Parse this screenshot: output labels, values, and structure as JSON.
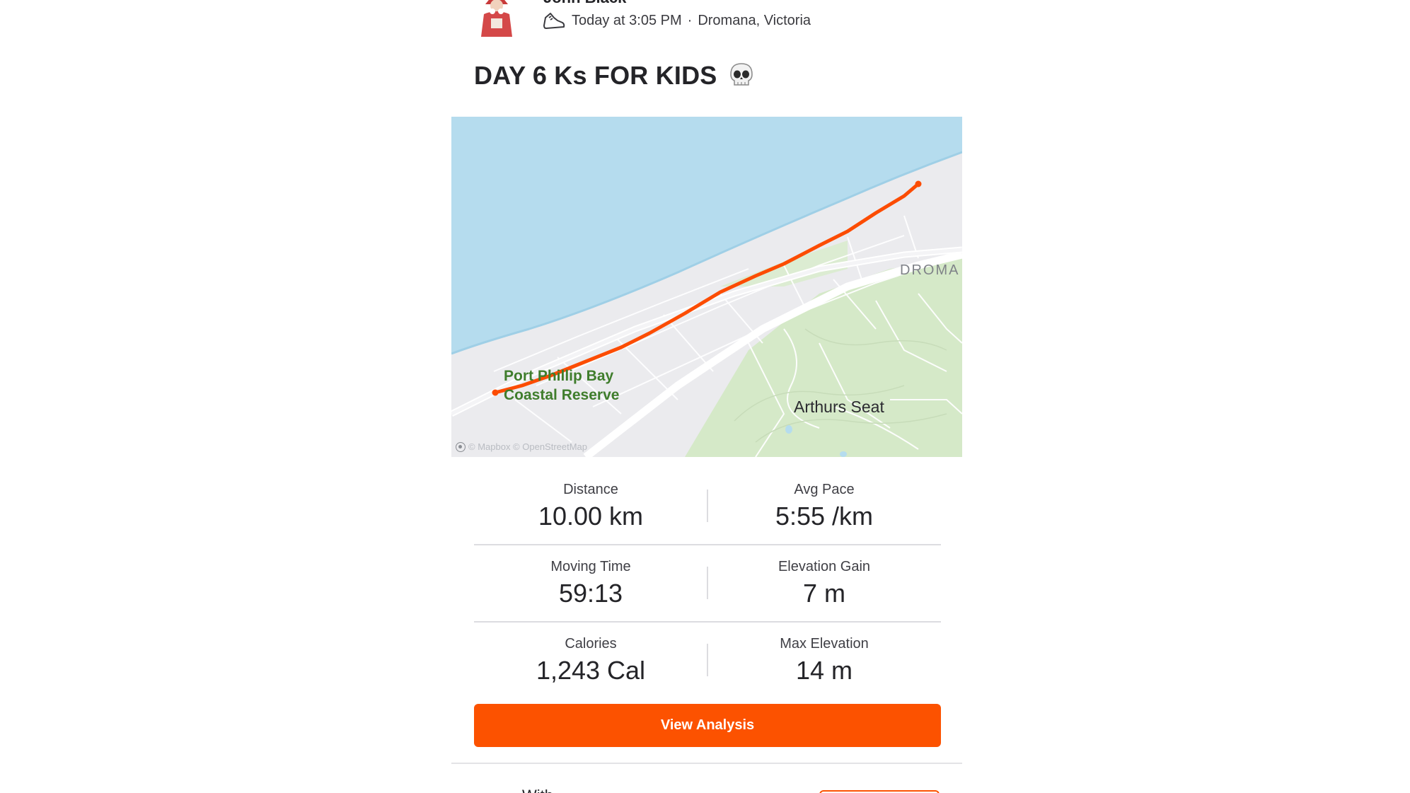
{
  "athlete": {
    "name": "John Black",
    "avatar_icon": "santa-avatar",
    "activity_type_icon": "running-shoe-icon",
    "timestamp": "Today at 3:05 PM",
    "separator": "·",
    "location": "Dromana, Victoria"
  },
  "activity": {
    "title": "DAY 6 Ks FOR KIDS",
    "title_emoji": "skull-icon"
  },
  "map": {
    "labels": {
      "reserve_line1": "Port Phillip Bay",
      "reserve_line2": "Coastal Reserve",
      "town": "DROMA",
      "peak": "Arthurs Seat",
      "attribution": "© Mapbox © OpenStreetMap"
    },
    "colors": {
      "water": "#b5dcee",
      "land": "#ebebee",
      "park": "#d3e8c6",
      "road": "#ffffff",
      "route": "#fc4c02"
    }
  },
  "stats": [
    {
      "left": {
        "label": "Distance",
        "value": "10.00 km"
      },
      "right": {
        "label": "Avg Pace",
        "value": "5:55 /km"
      }
    },
    {
      "left": {
        "label": "Moving Time",
        "value": "59:13"
      },
      "right": {
        "label": "Elevation Gain",
        "value": "7 m"
      }
    },
    {
      "left": {
        "label": "Calories",
        "value": "1,243 Cal"
      },
      "right": {
        "label": "Max Elevation",
        "value": "14 m"
      }
    }
  ],
  "actions": {
    "view_analysis_label": "View Analysis"
  },
  "footer": {
    "partial_text": "With"
  },
  "colors": {
    "brand": "#fc5200",
    "text": "#242428",
    "divider": "#dcdce0"
  }
}
